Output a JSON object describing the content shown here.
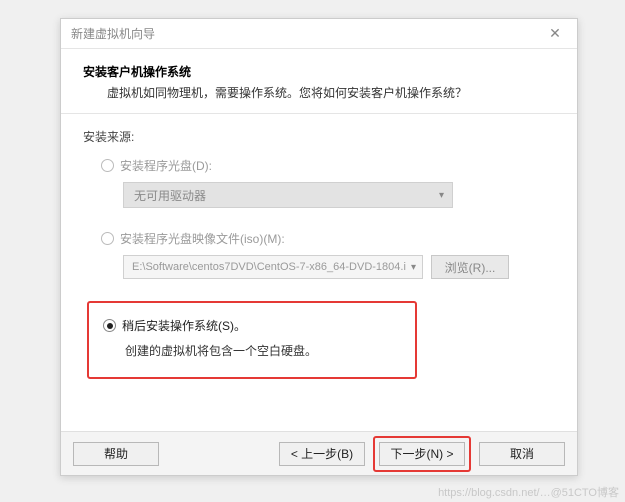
{
  "titlebar": {
    "title": "新建虚拟机向导",
    "close": "✕"
  },
  "header": {
    "title": "安装客户机操作系统",
    "subtitle": "虚拟机如同物理机，需要操作系统。您将如何安装客户机操作系统？"
  },
  "source_label": "安装来源:",
  "option_disc": {
    "label": "安装程序光盘(D):",
    "dropdown": "无可用驱动器"
  },
  "option_iso": {
    "label": "安装程序光盘映像文件(iso)(M):",
    "path": "E:\\Software\\centos7DVD\\CentOS-7-x86_64-DVD-1804.i",
    "browse": "浏览(R)..."
  },
  "option_later": {
    "label": "稍后安装操作系统(S)。",
    "note": "创建的虚拟机将包含一个空白硬盘。"
  },
  "footer": {
    "help": "帮助",
    "back": "< 上一步(B)",
    "next": "下一步(N) >",
    "cancel": "取消"
  },
  "watermark": "https://blog.csdn.net/…@51CTO博客"
}
